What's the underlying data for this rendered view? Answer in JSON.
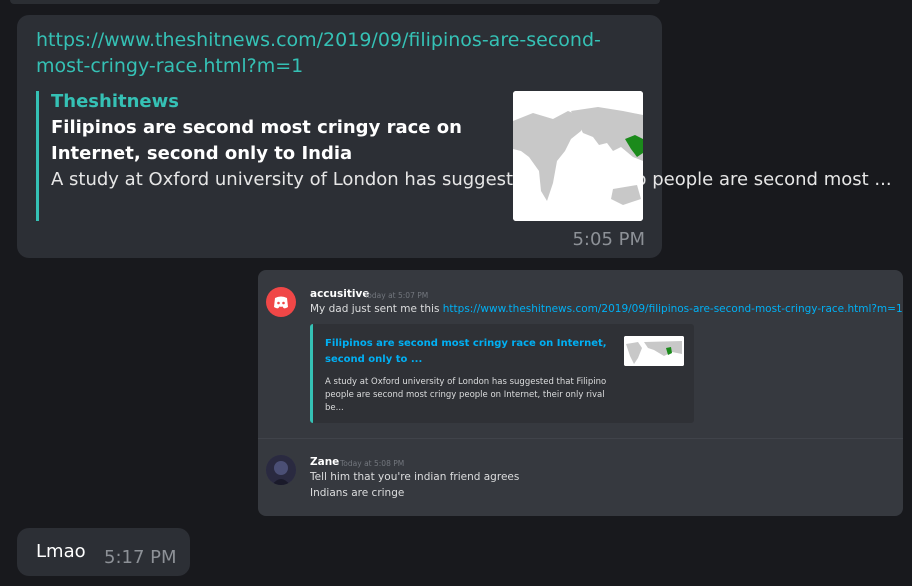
{
  "messages": {
    "link_message": {
      "url": "https://www.theshitnews.com/2019/09/filipinos-are-second-most-cringy-race.html?m=1",
      "preview": {
        "site": "Theshitnews",
        "title": "Filipinos are second most cringy race on Internet, second only to India",
        "description": "A study at Oxford university of London has suggested that Filipino people are second most ...",
        "thumbnail_icon": "world-map-india-highlighted"
      },
      "time": "5:05 PM"
    },
    "screenshot": {
      "first": {
        "username": "accusitive",
        "timestamp": "Today at 5:07 PM",
        "text": "My dad just sent me this",
        "link": "https://www.theshitnews.com/2019/09/filipinos-are-second-most-cringy-race.html?m=1",
        "embed": {
          "title": "Filipinos are second most cringy race on Internet, second only to ...",
          "description": "A study at Oxford university of London has suggested that Filipino people are second most cringy people on Internet, their only rival be..."
        }
      },
      "second": {
        "username": "Zane",
        "timestamp": "Today at 5:08 PM",
        "line1": "Tell him that you're indian friend agrees",
        "line2": "Indians are cringe"
      }
    },
    "reply": {
      "text": "Lmao",
      "time": "5:17 PM"
    }
  },
  "colors": {
    "background": "#18191d",
    "bubble": "#2c2f35",
    "accent": "#35c1b5",
    "discord_link": "#00b0f4",
    "discord_bg": "#36393f"
  }
}
